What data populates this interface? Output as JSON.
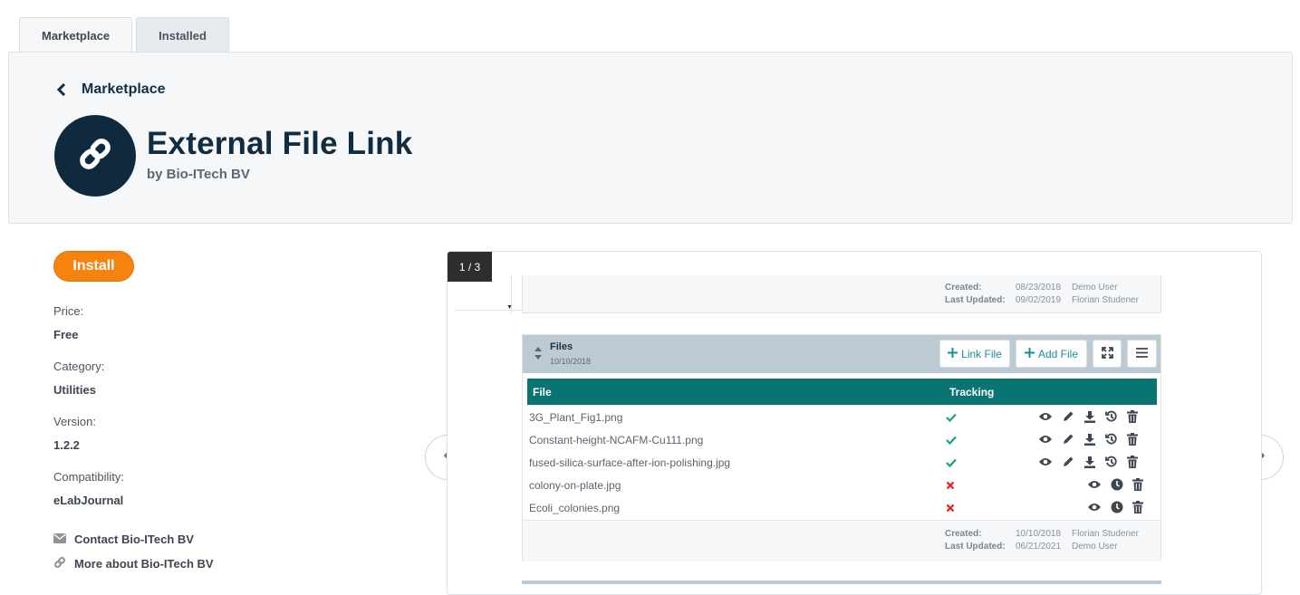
{
  "tabs": [
    {
      "label": "Marketplace",
      "active": true
    },
    {
      "label": "Installed",
      "active": false
    }
  ],
  "header": {
    "back_label": "Marketplace",
    "title": "External File Link",
    "vendor": "by Bio-ITech BV"
  },
  "sidebar": {
    "install_label": "Install",
    "price_label": "Price:",
    "price_value": "Free",
    "category_label": "Category:",
    "category_value": "Utilities",
    "version_label": "Version:",
    "version_value": "1.2.2",
    "compat_label": "Compatibility:",
    "compat_value": "eLabJournal",
    "contact_label": "Contact Bio-ITech BV",
    "more_label": "More about Bio-ITech BV"
  },
  "gallery": {
    "counter": "1 / 3",
    "prev_icon": "chevron-left-icon",
    "next_icon": "chevron-right-icon",
    "top_meta": {
      "created_label": "Created:",
      "created_date": "08/23/2018",
      "created_user": "Demo User",
      "updated_label": "Last Updated:",
      "updated_date": "09/02/2019",
      "updated_user": "Florian Studener"
    },
    "files": {
      "title": "Files",
      "date": "10/10/2018",
      "link_file_label": "Link File",
      "add_file_label": "Add File",
      "col_file": "File",
      "col_tracking": "Tracking",
      "rows": [
        {
          "name": "3G_Plant_Fig1.png",
          "tracked": true
        },
        {
          "name": "Constant-height-NCAFM-Cu111.png",
          "tracked": true
        },
        {
          "name": "fused-silica-surface-after-ion-polishing.jpg",
          "tracked": true
        },
        {
          "name": "colony-on-plate.jpg",
          "tracked": false
        },
        {
          "name": "Ecoli_colonies.png",
          "tracked": false
        }
      ],
      "footer": {
        "created_label": "Created:",
        "created_date": "10/10/2018",
        "created_user": "Florian Studener",
        "updated_label": "Last Updated:",
        "updated_date": "06/21/2021",
        "updated_user": "Demo User"
      }
    }
  },
  "colors": {
    "accent_orange": "#f7830f",
    "navy": "#102c40",
    "teal": "#0a7472",
    "check_green": "#16a085",
    "cross_red": "#e02020"
  }
}
